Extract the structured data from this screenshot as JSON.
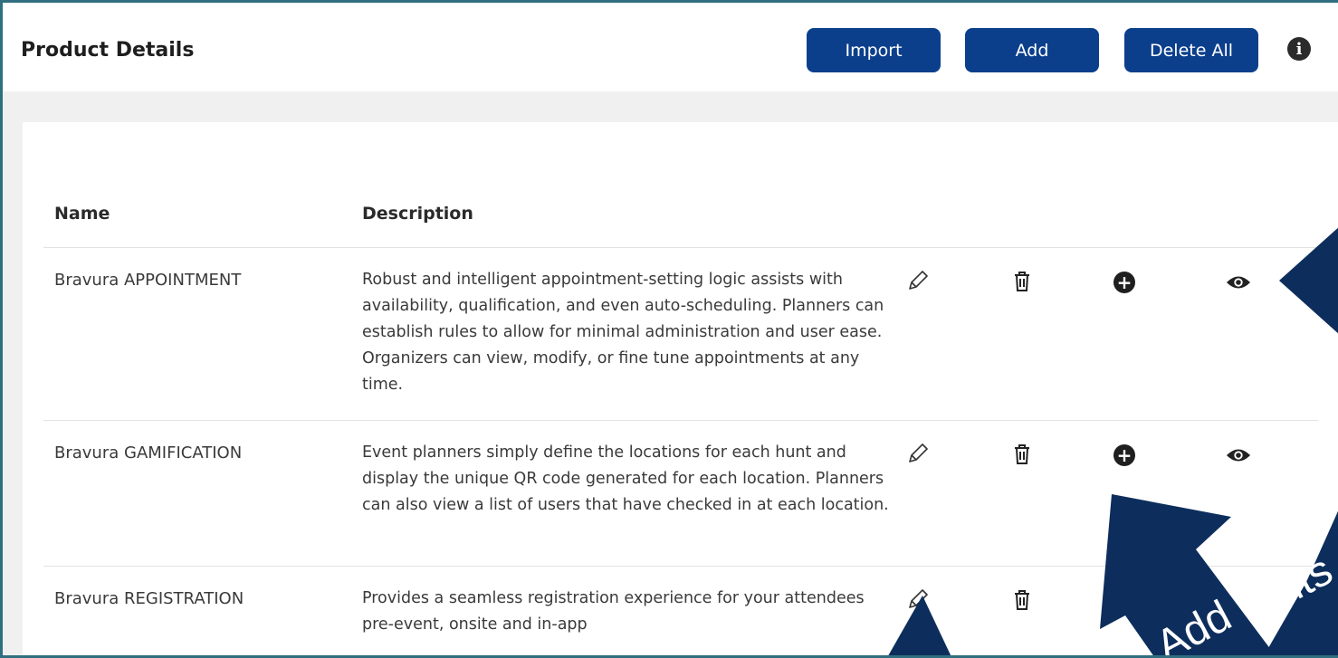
{
  "header": {
    "title": "Product Details",
    "import_label": "Import",
    "add_label": "Add",
    "delete_all_label": "Delete All",
    "info_glyph": "i"
  },
  "table": {
    "columns": [
      "Name",
      "Description"
    ],
    "rows": [
      {
        "name": "Bravura APPOINTMENT",
        "description": "Robust and intelligent appointment-setting logic assists with availability, qualification, and even auto-scheduling. Planners can establish rules to allow for minimal administration and user ease. Organizers can view, modify, or fine tune appointments at any time."
      },
      {
        "name": "Bravura GAMIFICATION",
        "description": "Event planners simply define the locations for each hunt and display the unique QR code generated for each location. Planners can also view a list of users that have checked in at each location."
      },
      {
        "name": "Bravura REGISTRATION",
        "description": "Provides a seamless registration experience for your attendees pre-event, onsite and in-app"
      }
    ]
  },
  "icons": {
    "edit": "pencil-icon",
    "delete": "trash-icon",
    "add": "plus-circle-icon",
    "view": "eye-icon",
    "info": "info-icon"
  },
  "overlay": {
    "text_1": "Add",
    "text_2": "ents"
  },
  "colors": {
    "button": "#0b3f8c",
    "arrow": "#0d2e5c",
    "frame": "#2f6f80"
  }
}
